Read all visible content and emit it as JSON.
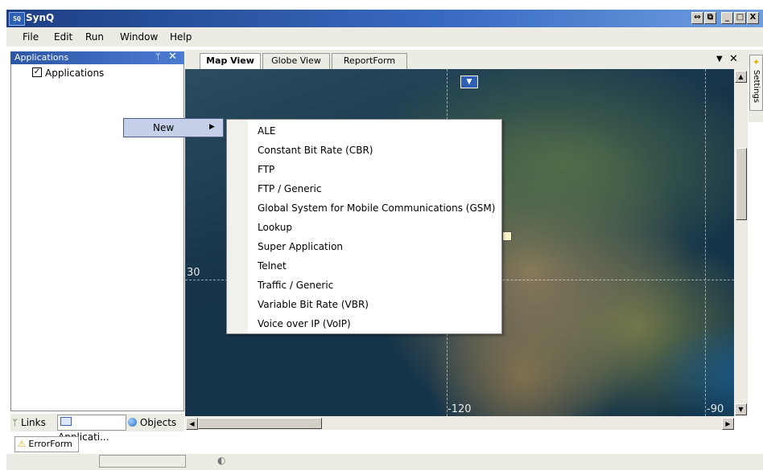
{
  "window": {
    "title": "SynQ",
    "logo_text": "SQ"
  },
  "menubar": {
    "items": [
      "File",
      "Edit",
      "Run",
      "Window",
      "Help"
    ]
  },
  "left_panel": {
    "title": "Applications",
    "pin": "ᛘ",
    "close": "✕",
    "tree": {
      "check": "✓",
      "label": "Applications"
    },
    "bottom_tabs": [
      "Links",
      "Applicati...",
      "Objects"
    ]
  },
  "bottom_panel": {
    "tab": "ErrorForm"
  },
  "doc_tabs": [
    "Map View",
    "Globe View",
    "ReportForm"
  ],
  "doc_tab_controls": {
    "dropdown": "▼",
    "close": "✕"
  },
  "map": {
    "coords": {
      "lat_left": "30",
      "lon_bottom": "-120",
      "lon_right": "-90"
    }
  },
  "settings_tab": {
    "label": "Settings"
  },
  "context_menu": {
    "new_label": "New",
    "arrow": "▶",
    "submenu_items": [
      "ALE",
      "Constant Bit Rate (CBR)",
      "FTP",
      "FTP / Generic",
      "Global System for Mobile Communications (GSM)",
      "Lookup",
      "Super Application",
      "Telnet",
      "Traffic / Generic",
      "Variable Bit Rate (VBR)",
      "Voice over IP (VoIP)"
    ]
  },
  "window_buttons": {
    "restore_extra": "⇔",
    "restore": "⧉",
    "minimize": "_",
    "maximize": "□",
    "close": "X"
  }
}
